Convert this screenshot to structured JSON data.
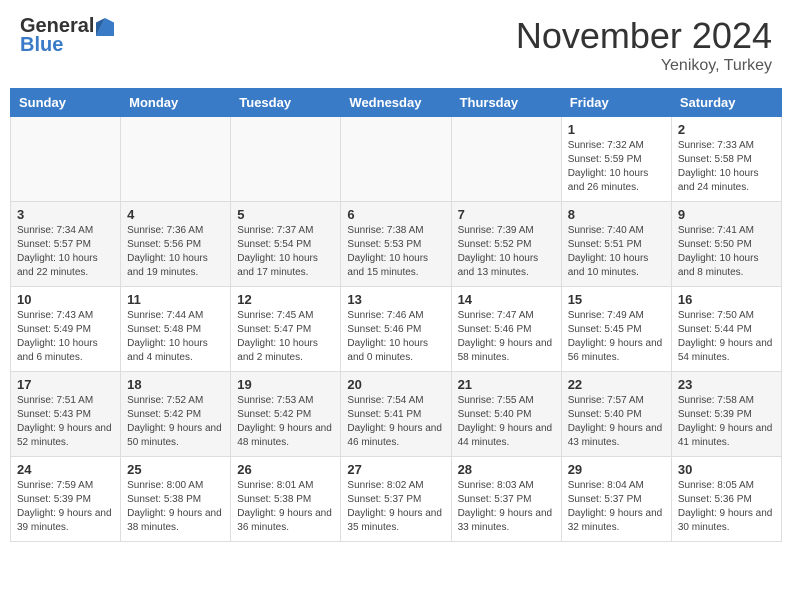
{
  "header": {
    "logo_general": "General",
    "logo_blue": "Blue",
    "month": "November 2024",
    "location": "Yenikoy, Turkey"
  },
  "weekdays": [
    "Sunday",
    "Monday",
    "Tuesday",
    "Wednesday",
    "Thursday",
    "Friday",
    "Saturday"
  ],
  "weeks": [
    [
      {
        "day": "",
        "info": ""
      },
      {
        "day": "",
        "info": ""
      },
      {
        "day": "",
        "info": ""
      },
      {
        "day": "",
        "info": ""
      },
      {
        "day": "",
        "info": ""
      },
      {
        "day": "1",
        "info": "Sunrise: 7:32 AM\nSunset: 5:59 PM\nDaylight: 10 hours and 26 minutes."
      },
      {
        "day": "2",
        "info": "Sunrise: 7:33 AM\nSunset: 5:58 PM\nDaylight: 10 hours and 24 minutes."
      }
    ],
    [
      {
        "day": "3",
        "info": "Sunrise: 7:34 AM\nSunset: 5:57 PM\nDaylight: 10 hours and 22 minutes."
      },
      {
        "day": "4",
        "info": "Sunrise: 7:36 AM\nSunset: 5:56 PM\nDaylight: 10 hours and 19 minutes."
      },
      {
        "day": "5",
        "info": "Sunrise: 7:37 AM\nSunset: 5:54 PM\nDaylight: 10 hours and 17 minutes."
      },
      {
        "day": "6",
        "info": "Sunrise: 7:38 AM\nSunset: 5:53 PM\nDaylight: 10 hours and 15 minutes."
      },
      {
        "day": "7",
        "info": "Sunrise: 7:39 AM\nSunset: 5:52 PM\nDaylight: 10 hours and 13 minutes."
      },
      {
        "day": "8",
        "info": "Sunrise: 7:40 AM\nSunset: 5:51 PM\nDaylight: 10 hours and 10 minutes."
      },
      {
        "day": "9",
        "info": "Sunrise: 7:41 AM\nSunset: 5:50 PM\nDaylight: 10 hours and 8 minutes."
      }
    ],
    [
      {
        "day": "10",
        "info": "Sunrise: 7:43 AM\nSunset: 5:49 PM\nDaylight: 10 hours and 6 minutes."
      },
      {
        "day": "11",
        "info": "Sunrise: 7:44 AM\nSunset: 5:48 PM\nDaylight: 10 hours and 4 minutes."
      },
      {
        "day": "12",
        "info": "Sunrise: 7:45 AM\nSunset: 5:47 PM\nDaylight: 10 hours and 2 minutes."
      },
      {
        "day": "13",
        "info": "Sunrise: 7:46 AM\nSunset: 5:46 PM\nDaylight: 10 hours and 0 minutes."
      },
      {
        "day": "14",
        "info": "Sunrise: 7:47 AM\nSunset: 5:46 PM\nDaylight: 9 hours and 58 minutes."
      },
      {
        "day": "15",
        "info": "Sunrise: 7:49 AM\nSunset: 5:45 PM\nDaylight: 9 hours and 56 minutes."
      },
      {
        "day": "16",
        "info": "Sunrise: 7:50 AM\nSunset: 5:44 PM\nDaylight: 9 hours and 54 minutes."
      }
    ],
    [
      {
        "day": "17",
        "info": "Sunrise: 7:51 AM\nSunset: 5:43 PM\nDaylight: 9 hours and 52 minutes."
      },
      {
        "day": "18",
        "info": "Sunrise: 7:52 AM\nSunset: 5:42 PM\nDaylight: 9 hours and 50 minutes."
      },
      {
        "day": "19",
        "info": "Sunrise: 7:53 AM\nSunset: 5:42 PM\nDaylight: 9 hours and 48 minutes."
      },
      {
        "day": "20",
        "info": "Sunrise: 7:54 AM\nSunset: 5:41 PM\nDaylight: 9 hours and 46 minutes."
      },
      {
        "day": "21",
        "info": "Sunrise: 7:55 AM\nSunset: 5:40 PM\nDaylight: 9 hours and 44 minutes."
      },
      {
        "day": "22",
        "info": "Sunrise: 7:57 AM\nSunset: 5:40 PM\nDaylight: 9 hours and 43 minutes."
      },
      {
        "day": "23",
        "info": "Sunrise: 7:58 AM\nSunset: 5:39 PM\nDaylight: 9 hours and 41 minutes."
      }
    ],
    [
      {
        "day": "24",
        "info": "Sunrise: 7:59 AM\nSunset: 5:39 PM\nDaylight: 9 hours and 39 minutes."
      },
      {
        "day": "25",
        "info": "Sunrise: 8:00 AM\nSunset: 5:38 PM\nDaylight: 9 hours and 38 minutes."
      },
      {
        "day": "26",
        "info": "Sunrise: 8:01 AM\nSunset: 5:38 PM\nDaylight: 9 hours and 36 minutes."
      },
      {
        "day": "27",
        "info": "Sunrise: 8:02 AM\nSunset: 5:37 PM\nDaylight: 9 hours and 35 minutes."
      },
      {
        "day": "28",
        "info": "Sunrise: 8:03 AM\nSunset: 5:37 PM\nDaylight: 9 hours and 33 minutes."
      },
      {
        "day": "29",
        "info": "Sunrise: 8:04 AM\nSunset: 5:37 PM\nDaylight: 9 hours and 32 minutes."
      },
      {
        "day": "30",
        "info": "Sunrise: 8:05 AM\nSunset: 5:36 PM\nDaylight: 9 hours and 30 minutes."
      }
    ]
  ]
}
